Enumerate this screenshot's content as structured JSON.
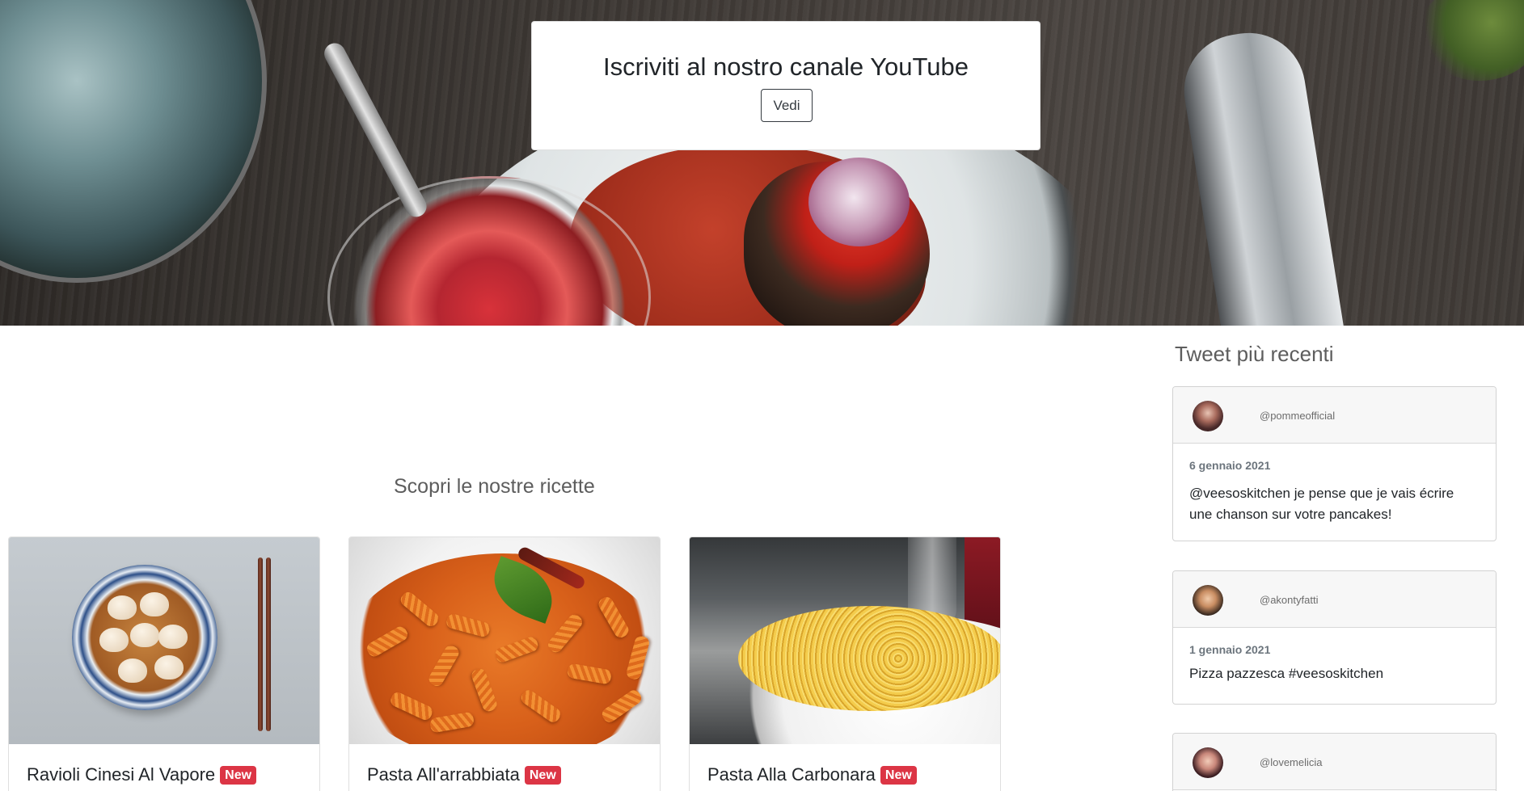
{
  "hero": {
    "card_title": "Iscriviti al nostro canale YouTube",
    "button_label": "Vedi"
  },
  "recipes": {
    "heading": "Scopri le nostre ricette",
    "badge_label": "New",
    "items": [
      {
        "title": "Ravioli Cinesi Al Vapore",
        "badge": "New"
      },
      {
        "title": "Pasta All'arrabbiata",
        "badge": "New"
      },
      {
        "title": "Pasta Alla Carbonara",
        "badge": "New"
      }
    ]
  },
  "tweets": {
    "heading": "Tweet più recenti",
    "items": [
      {
        "handle": "@pommeofficial",
        "date": "6 gennaio 2021",
        "text": "@veesoskitchen je pense que je vais écrire une chanson sur votre pancakes!"
      },
      {
        "handle": "@akontyfatti",
        "date": "1 gennaio 2021",
        "text": "Pizza pazzesca #veesoskitchen"
      },
      {
        "handle": "@lovemelicia",
        "date": "",
        "text": ""
      }
    ]
  },
  "colors": {
    "badge": "#dc3545",
    "heading_gray": "#5d5d5d",
    "card_header": "#f7f7f7"
  }
}
